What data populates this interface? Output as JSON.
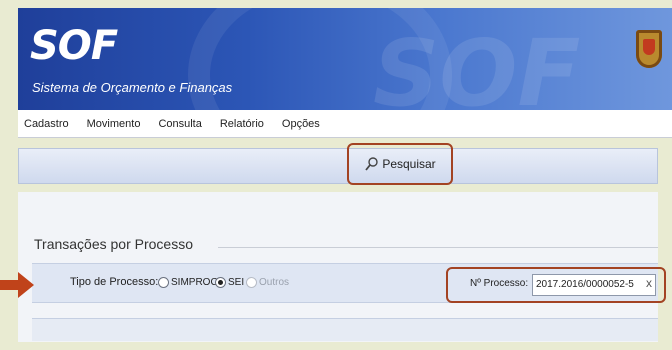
{
  "app": {
    "logo": "SOF",
    "subtitle": "Sistema de Orçamento e Finanças"
  },
  "menu": {
    "items": [
      {
        "label": "Cadastro"
      },
      {
        "label": "Movimento"
      },
      {
        "label": "Consulta"
      },
      {
        "label": "Relatório"
      },
      {
        "label": "Opções"
      }
    ]
  },
  "toolbar": {
    "search_label": "Pesquisar"
  },
  "section": {
    "title": "Transações por Processo"
  },
  "form": {
    "tipo_label": "Tipo de Processo:",
    "radios": [
      {
        "label": "SIMPROC",
        "checked": false
      },
      {
        "label": "SEI",
        "checked": true
      },
      {
        "label": "Outros",
        "checked": false,
        "disabled": true
      }
    ],
    "processo_label": "Nº Processo:",
    "processo_value": "2017.2016/0000052-5",
    "clear_symbol": "x"
  },
  "colors": {
    "highlight": "#a34323",
    "header_dark": "#1f3f9a",
    "arrow": "#c0431a"
  },
  "icons": {
    "search": "search-icon",
    "arrow": "arrow-right-icon",
    "crest": "crest-icon"
  }
}
